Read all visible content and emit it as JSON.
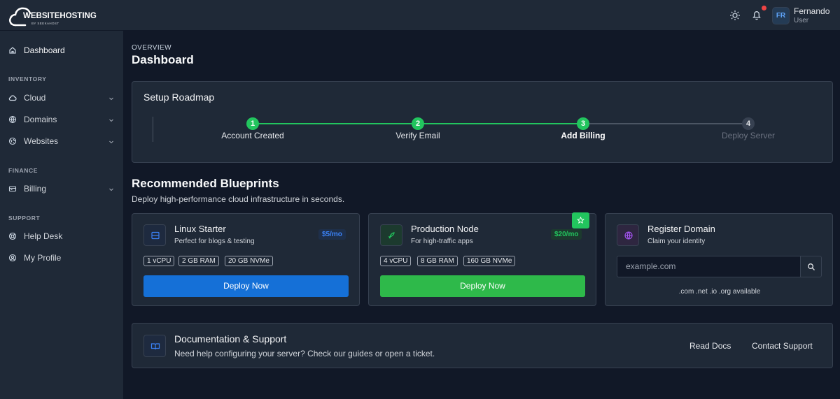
{
  "header": {
    "logo_text": "WEBSITEHOSTING",
    "logo_sub": "BY SEEKAHOST",
    "user_initials": "FR",
    "user_name": "Fernando",
    "user_role": "User"
  },
  "sidebar": {
    "items": [
      {
        "label": "Dashboard",
        "icon": "home-icon"
      }
    ],
    "sections": [
      {
        "title": "INVENTORY",
        "items": [
          {
            "label": "Cloud",
            "icon": "cloud-icon"
          },
          {
            "label": "Domains",
            "icon": "globe-icon"
          },
          {
            "label": "Websites",
            "icon": "web-icon"
          }
        ]
      },
      {
        "title": "FINANCE",
        "items": [
          {
            "label": "Billing",
            "icon": "wallet-icon"
          }
        ]
      },
      {
        "title": "SUPPORT",
        "items": [
          {
            "label": "Help Desk",
            "icon": "lifebuoy-icon"
          },
          {
            "label": "My Profile",
            "icon": "user-icon"
          }
        ]
      }
    ]
  },
  "main": {
    "breadcrumb": "OVERVIEW",
    "title": "Dashboard",
    "roadmap": {
      "title": "Setup Roadmap",
      "steps": [
        {
          "number": "1",
          "label": "Account Created",
          "state": "done"
        },
        {
          "number": "2",
          "label": "Verify Email",
          "state": "done"
        },
        {
          "number": "3",
          "label": "Add Billing",
          "state": "current"
        },
        {
          "number": "4",
          "label": "Deploy Server",
          "state": "todo"
        }
      ]
    },
    "blueprints": {
      "title": "Recommended Blueprints",
      "subtitle": "Deploy high-performance cloud infrastructure in seconds.",
      "cards": [
        {
          "name": "Linux Starter",
          "desc": "Perfect for blogs & testing",
          "price": "$5/mo",
          "specs": [
            "1 vCPU",
            "2 GB RAM",
            "20 GB NVMe"
          ],
          "button": "Deploy Now",
          "accent": "#1570d7"
        },
        {
          "name": "Production Node",
          "desc": "For high-traffic apps",
          "price": "$20/mo",
          "specs": [
            "4 vCPU",
            "8 GB RAM",
            "160 GB NVMe"
          ],
          "button": "Deploy Now",
          "accent": "#2eb94a"
        }
      ],
      "domain": {
        "name": "Register Domain",
        "desc": "Claim your identity",
        "placeholder": "example.com",
        "note": ".com .net .io .org available"
      }
    },
    "support": {
      "title": "Documentation & Support",
      "desc": "Need help configuring your server? Check our guides or open a ticket.",
      "read_docs": "Read Docs",
      "contact": "Contact Support"
    }
  },
  "colors": {
    "background": "#111827",
    "panel": "#1f2937",
    "primary_blue": "#1570d7",
    "success_green": "#22c55e",
    "notification_red": "#ef4444"
  }
}
